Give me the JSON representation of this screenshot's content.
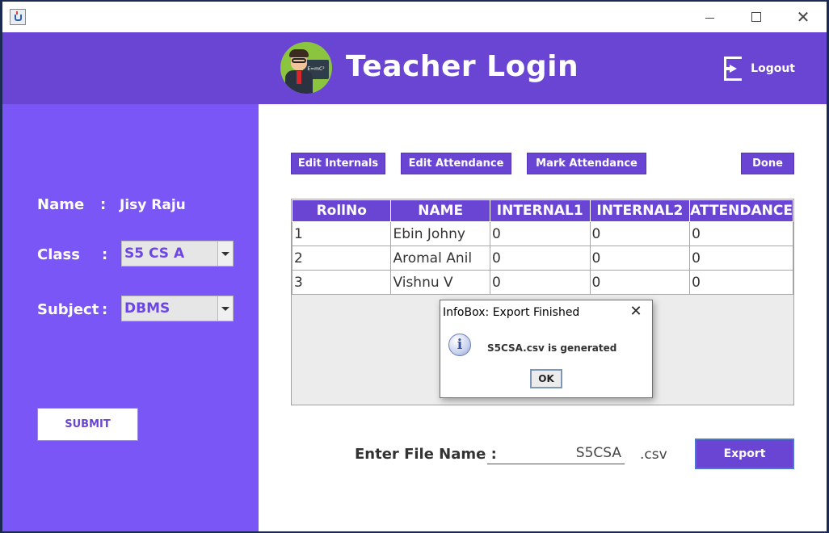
{
  "window": {
    "icon": "java-cup-icon",
    "controls": [
      "minimize-icon",
      "maximize-icon",
      "close-icon"
    ],
    "close_glyph": "✕"
  },
  "header": {
    "title": "Teacher Login",
    "avatar_board_text": "E=mC²",
    "logout_label": "Logout",
    "background": "#6a45d4"
  },
  "sidebar": {
    "background": "#7b56f6",
    "name_label": "Name",
    "name_value": "Jisy Raju",
    "class_label": "Class",
    "class_value": "S5 CS A",
    "subject_label": "Subject",
    "subject_value": "DBMS",
    "colon": ":",
    "submit_label": "SUBMIT"
  },
  "toolbar": {
    "edit_internals": "Edit Internals",
    "edit_attendance": "Edit Attendance",
    "mark_attendance": "Mark Attendance",
    "done": "Done"
  },
  "table": {
    "columns": [
      "RollNo",
      "NAME",
      "INTERNAL1",
      "INTERNAL2",
      "ATTENDANCE"
    ],
    "rows": [
      [
        "1",
        "Ebin Johny",
        "0",
        "0",
        "0"
      ],
      [
        "2",
        "Aromal Anil",
        "0",
        "0",
        "0"
      ],
      [
        "3",
        "Vishnu V",
        "0",
        "0",
        "0"
      ]
    ]
  },
  "dialog": {
    "title": "InfoBox: Export Finished",
    "message": "S5CSA.csv is generated",
    "ok_label": "OK",
    "icon_glyph": "i",
    "close_glyph": "✕"
  },
  "export": {
    "file_label": "Enter File Name :",
    "file_value": "S5CSA",
    "extension": ".csv",
    "button_label": "Export"
  }
}
